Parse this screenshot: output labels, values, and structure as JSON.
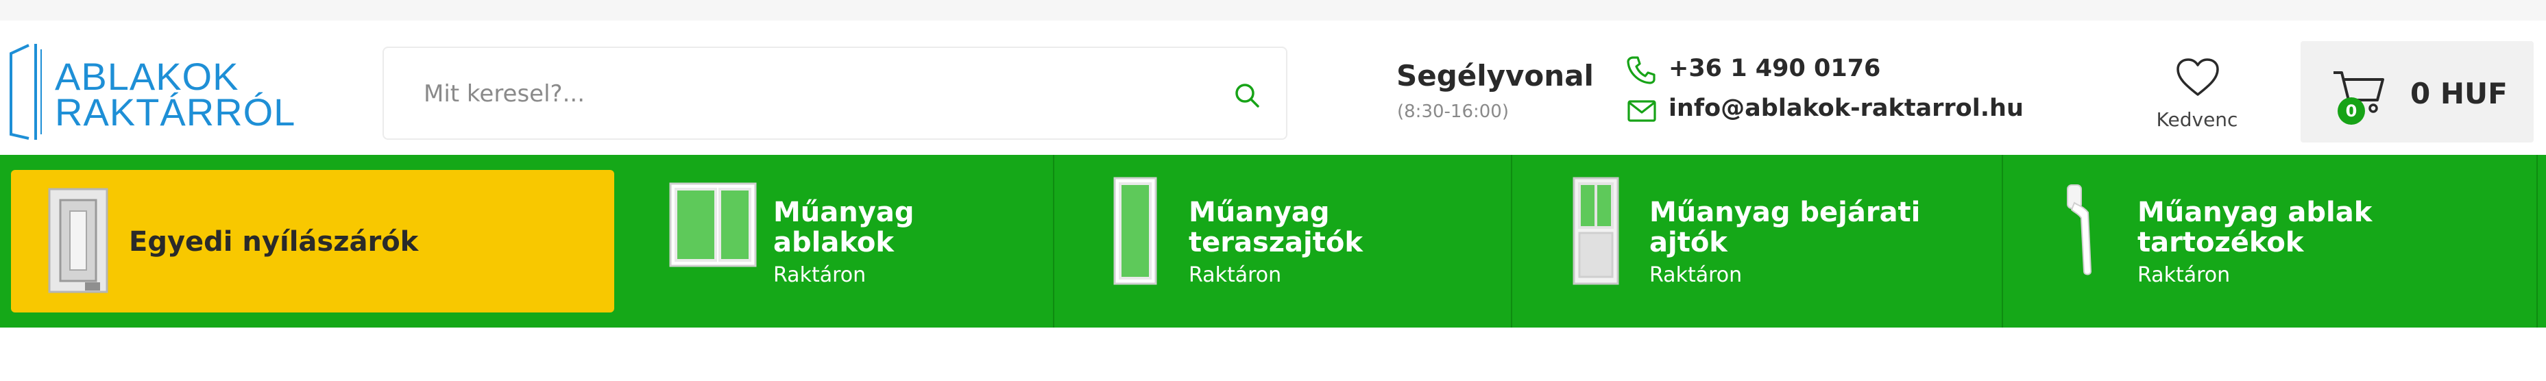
{
  "logo": {
    "line1": "ABLAKOK",
    "line2": "RAKTÁRRÓL",
    "color": "#1e8fd6"
  },
  "search": {
    "placeholder": "Mit keresel?...",
    "icon": "search-icon"
  },
  "help": {
    "title": "Segélyvonal",
    "hours": "(8:30-16:00)"
  },
  "contact": {
    "phone": "+36 1 490 0176",
    "email": "info@ablakok-raktarrol.hu",
    "accent": "#17a317"
  },
  "favourites": {
    "label": "Kedvenc",
    "icon": "heart-icon"
  },
  "cart": {
    "count": "0",
    "total": "0 HUF",
    "icon": "cart-icon"
  },
  "categories": {
    "active": {
      "label": "Egyedi nyílászárók",
      "color": "#f8c800"
    },
    "items": [
      {
        "title": "Műanyag ablakok",
        "line1": "Műanyag",
        "line2": "ablakok",
        "sub": "Raktáron"
      },
      {
        "title": "Műanyag teraszajtók",
        "line1": "Műanyag",
        "line2": "teraszajtók",
        "sub": "Raktáron"
      },
      {
        "title": "Műanyag bejárati ajtók",
        "line1": "Műanyag bejárati",
        "line2": "ajtók",
        "sub": "Raktáron"
      },
      {
        "title": "Műanyag ablak tartozékok",
        "line1": "Műanyag ablak",
        "line2": "tartozékok",
        "sub": "Raktáron"
      }
    ],
    "bar_color": "#15a818"
  }
}
